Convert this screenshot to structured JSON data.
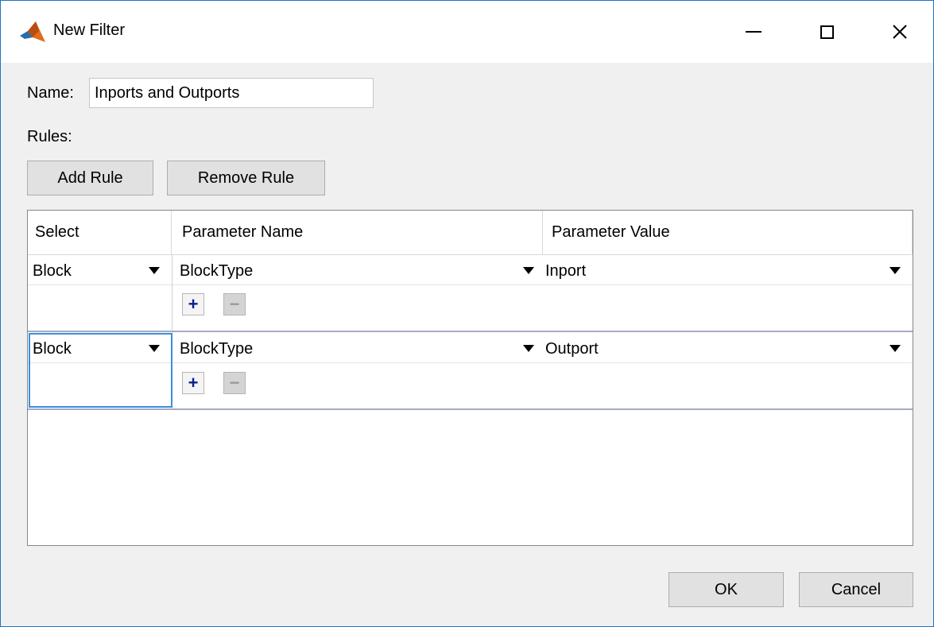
{
  "window": {
    "title": "New Filter",
    "controls": {
      "minimize": "—",
      "maximize": "☐",
      "close": "✕"
    }
  },
  "form": {
    "name_label": "Name:",
    "name_value": "Inports and Outports",
    "rules_label": "Rules:",
    "add_rule_label": "Add Rule",
    "remove_rule_label": "Remove Rule"
  },
  "table": {
    "headers": [
      "Select",
      "Parameter Name",
      "Parameter Value"
    ],
    "rows": [
      {
        "select": "Block",
        "param_name": "BlockType",
        "param_value": "Inport",
        "plus": "+",
        "minus": "−"
      },
      {
        "select": "Block",
        "param_name": "BlockType",
        "param_value": "Outport",
        "plus": "+",
        "minus": "−"
      }
    ]
  },
  "footer": {
    "ok_label": "OK",
    "cancel_label": "Cancel"
  },
  "colors": {
    "accent_border": "#1a73c8",
    "focus": "#3d8fd9",
    "plus": "#0a1e8c"
  }
}
